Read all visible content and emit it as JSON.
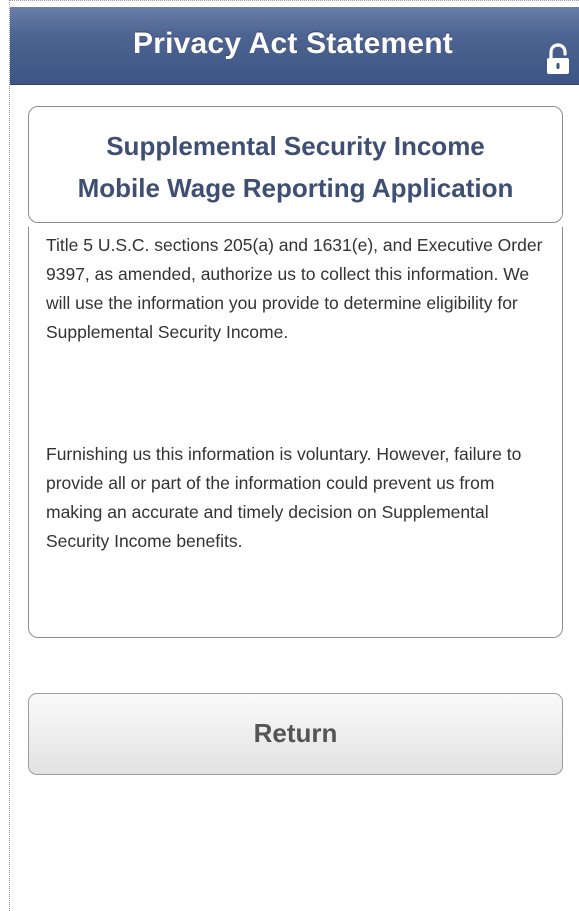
{
  "header": {
    "title": "Privacy Act Statement",
    "lock_icon": "unlocked-padlock-icon"
  },
  "title_box": {
    "line1": "Supplemental Security Income",
    "line2": "Mobile Wage Reporting Application"
  },
  "statement": {
    "paragraphs": [
      "Title 5 U.S.C. sections 205(a) and 1631(e), and Executive Order 9397, as amended, authorize us to collect this information.  We will use the information you provide to determine eligibility for Supplemental Security Income.",
      "Furnishing us this information is voluntary. However, failure to provide all or part of the information could prevent us from making an accurate and timely decision on Supplemental Security Income benefits."
    ]
  },
  "actions": {
    "return_label": "Return"
  },
  "colors": {
    "header_bar": "#4e6593",
    "title_text": "#3e4f73",
    "body_text": "#333333",
    "button_text": "#555555"
  }
}
